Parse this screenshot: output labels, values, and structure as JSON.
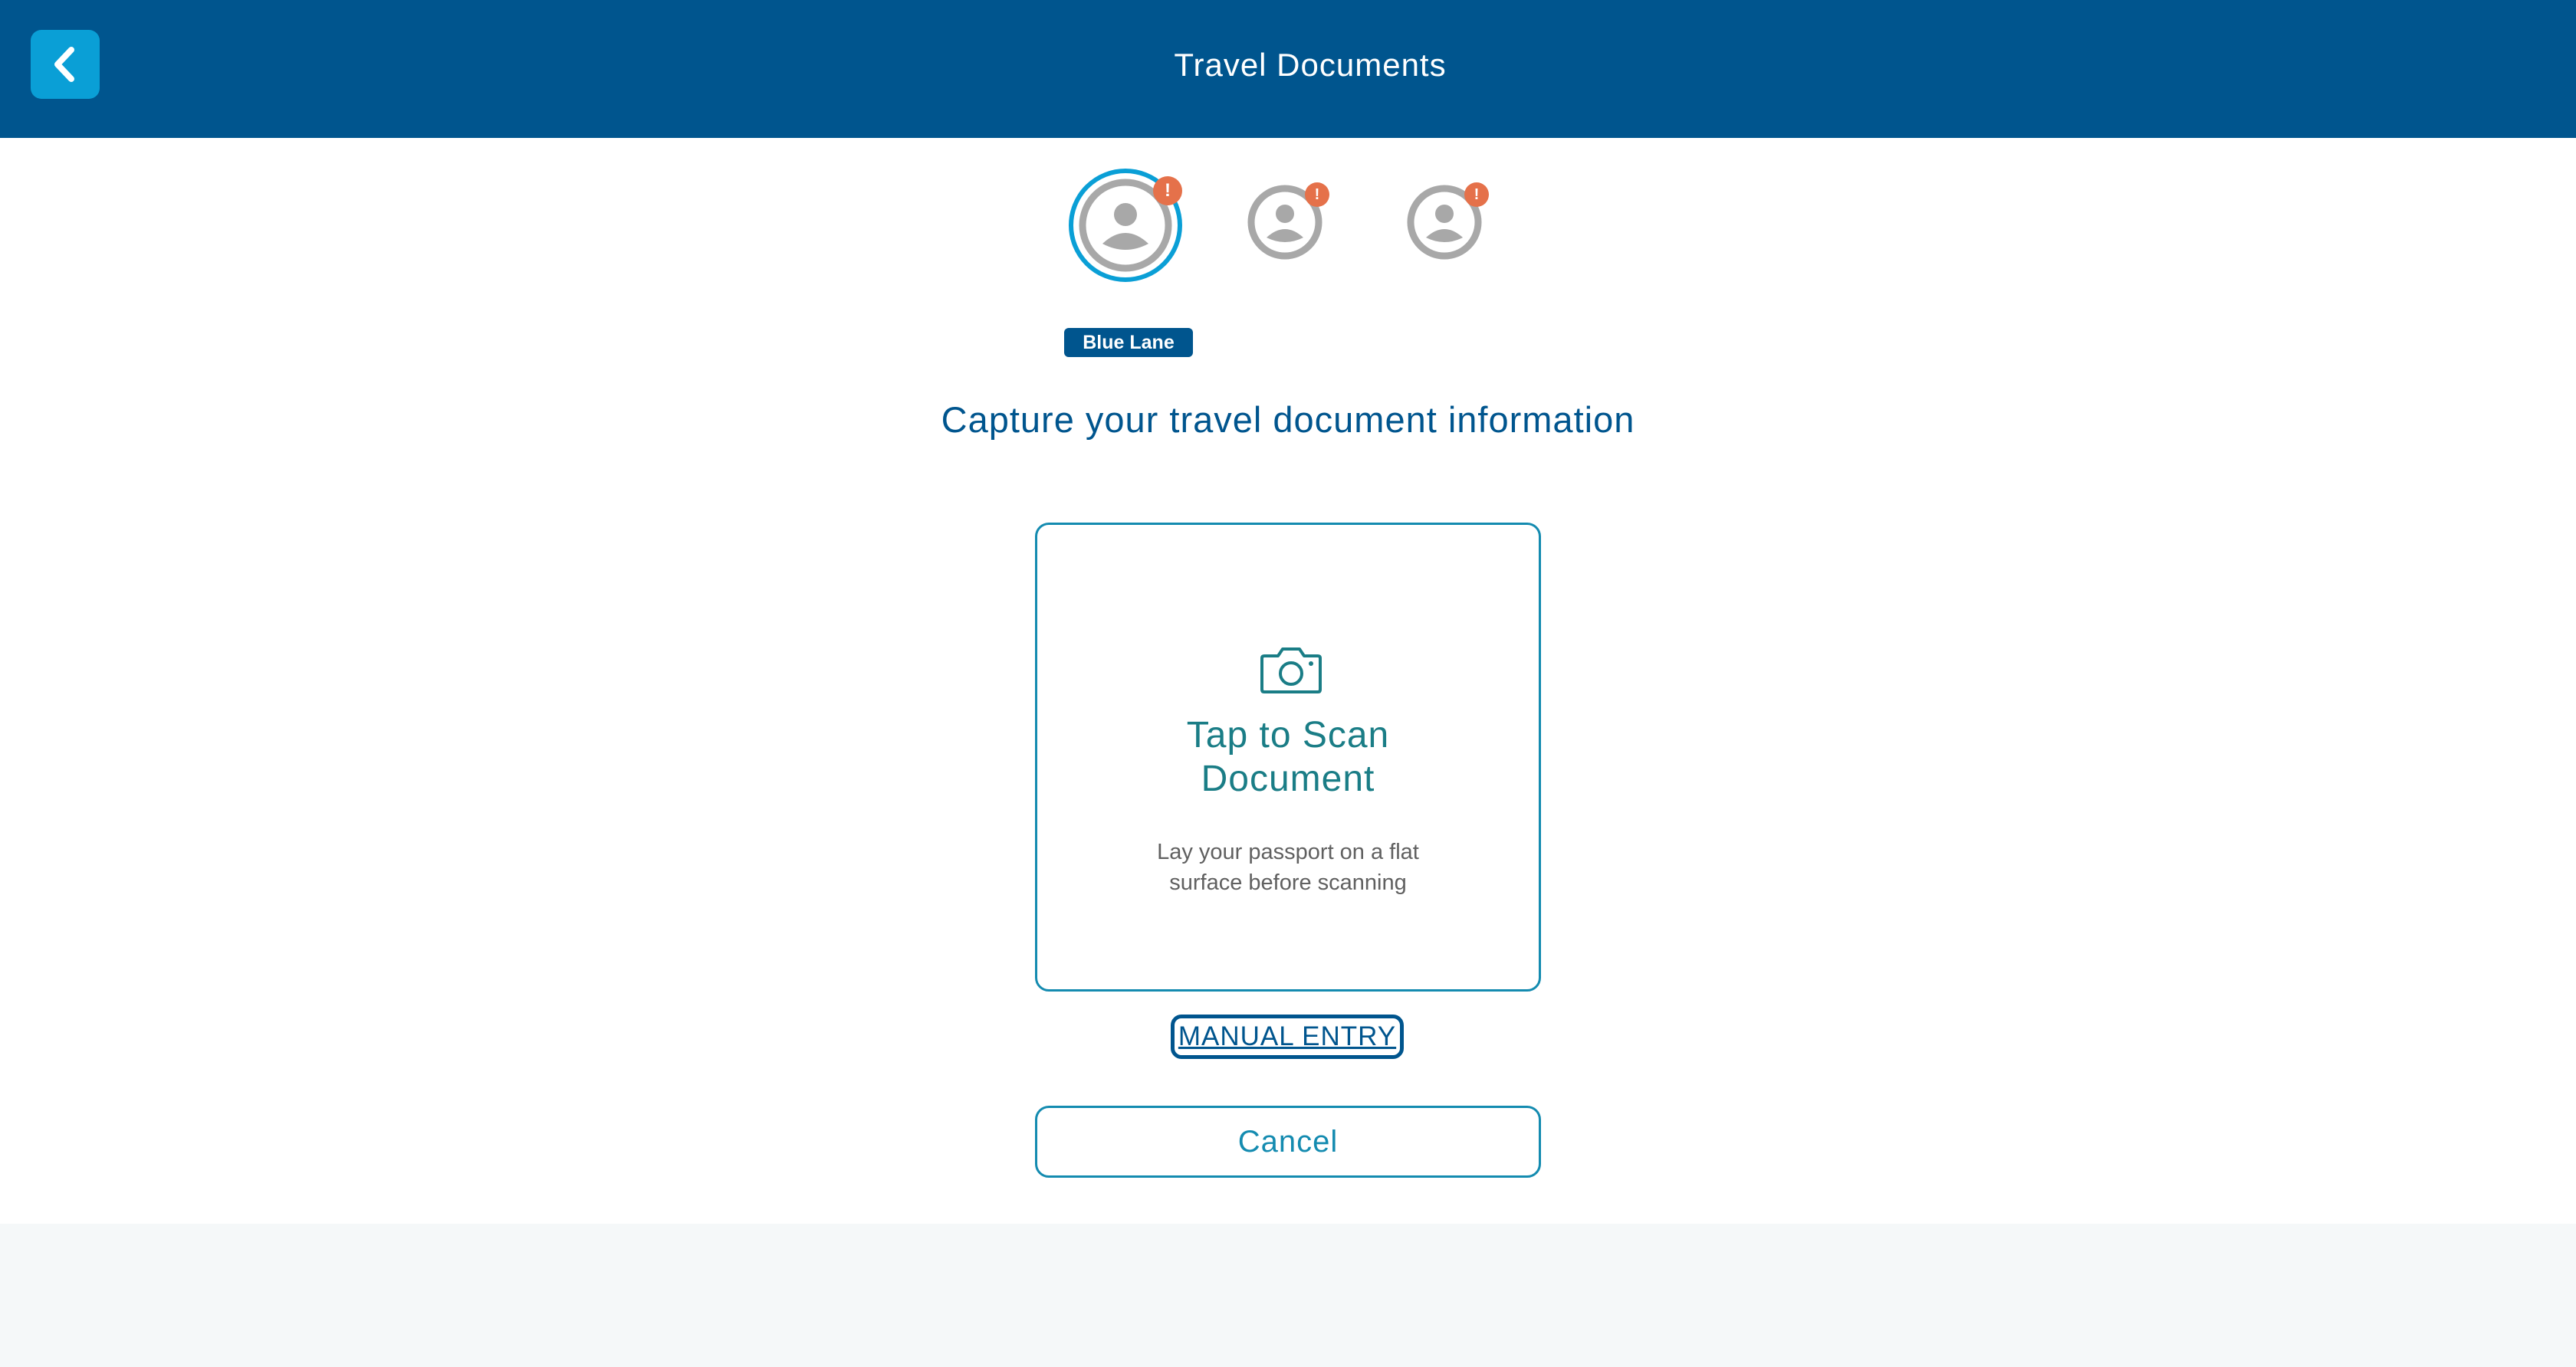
{
  "header": {
    "title": "Travel Documents",
    "back_icon": "chevron-left-icon"
  },
  "guests": [
    {
      "state": "selected",
      "icon": "user-avatar-icon",
      "alert": "!"
    },
    {
      "state": "unselected",
      "icon": "user-avatar-icon",
      "alert": "!"
    },
    {
      "state": "unselected",
      "icon": "user-avatar-icon",
      "alert": "!"
    }
  ],
  "lane_badge": "Blue Lane",
  "main": {
    "heading": "Capture your travel document information",
    "scan_card": {
      "icon": "camera-icon",
      "title_line1": "Tap to Scan",
      "title_line2": "Document",
      "hint_line1": "Lay your passport on a flat",
      "hint_line2": "surface before scanning"
    },
    "manual_entry_label": "MANUAL ENTRY",
    "cancel_label": "Cancel"
  },
  "colors": {
    "header_bg": "#00558e",
    "accent": "#0a9fd6",
    "teal": "#1a7d86",
    "alert": "#e5714a",
    "avatar_gray": "#a8a8a8"
  }
}
